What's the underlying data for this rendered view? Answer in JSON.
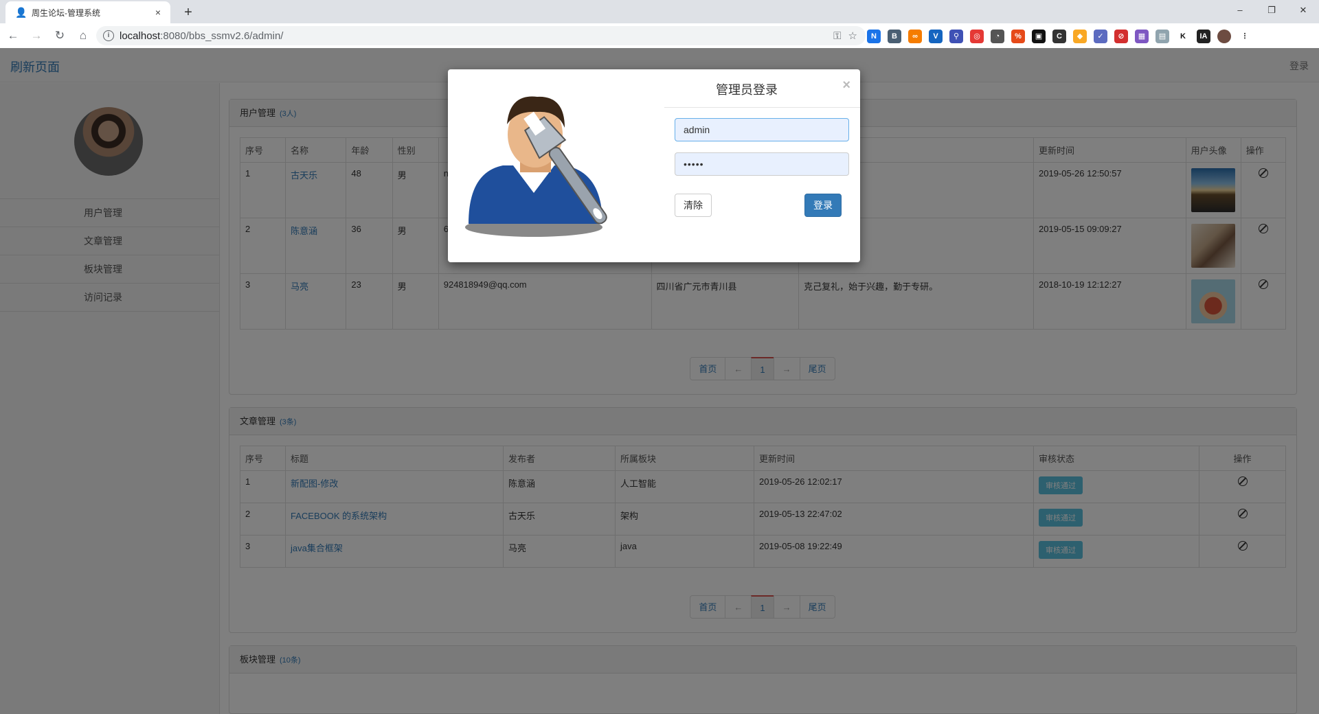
{
  "browser": {
    "tab_title": "周生论坛-管理系统",
    "tab_close": "×",
    "new_tab": "+",
    "url_host": "localhost",
    "url_path": ":8080/bbs_ssmv2.6/admin/",
    "win_minimize": "–",
    "win_restore": "❐",
    "win_close": "✕"
  },
  "header": {
    "brand": "刷新页面",
    "login": "登录"
  },
  "sidebar": {
    "items": [
      {
        "label": "用户管理"
      },
      {
        "label": "文章管理"
      },
      {
        "label": "板块管理"
      },
      {
        "label": "访问记录"
      }
    ]
  },
  "users_panel": {
    "title": "用户管理",
    "count": "(3人)",
    "columns": [
      "序号",
      "名称",
      "年龄",
      "性别",
      "",
      "",
      "",
      "更新时间",
      "用户头像",
      "操作"
    ],
    "rows": [
      {
        "no": "1",
        "name": "古天乐",
        "age": "48",
        "gender": "男",
        "email": "n",
        "address": "",
        "bio": "",
        "updated": "2019-05-26 12:50:57"
      },
      {
        "no": "2",
        "name": "陈意涵",
        "age": "36",
        "gender": "男",
        "email": "6",
        "address": "",
        "bio": "",
        "updated": "2019-05-15 09:09:27"
      },
      {
        "no": "3",
        "name": "马亮",
        "age": "23",
        "gender": "男",
        "email": "924818949@qq.com",
        "address": "四川省广元市青川县",
        "bio": "克己复礼，始于兴趣，勤于专研。",
        "updated": "2018-10-19 12:12:27"
      }
    ]
  },
  "articles_panel": {
    "title": "文章管理",
    "count": "(3条)",
    "columns": [
      "序号",
      "标题",
      "发布者",
      "所属板块",
      "更新时间",
      "审核状态",
      "操作"
    ],
    "rows": [
      {
        "no": "1",
        "title": "新配图-修改",
        "author": "陈意涵",
        "board": "人工智能",
        "updated": "2019-05-26 12:02:17",
        "status": "审核通过"
      },
      {
        "no": "2",
        "title": "FACEBOOK 的系统架构",
        "author": "古天乐",
        "board": "架构",
        "updated": "2019-05-13 22:47:02",
        "status": "审核通过"
      },
      {
        "no": "3",
        "title": "java集合框架",
        "author": "马亮",
        "board": "java",
        "updated": "2019-05-08 19:22:49",
        "status": "审核通过"
      }
    ]
  },
  "boards_panel": {
    "title": "板块管理",
    "count": "(10条)"
  },
  "pager": {
    "first": "首页",
    "prev": "←",
    "page": "1",
    "next": "→",
    "last": "尾页"
  },
  "modal": {
    "title": "管理员登录",
    "close": "×",
    "username_value": "admin",
    "password_value": "•••••",
    "clear_label": "清除",
    "login_label": "登录"
  }
}
